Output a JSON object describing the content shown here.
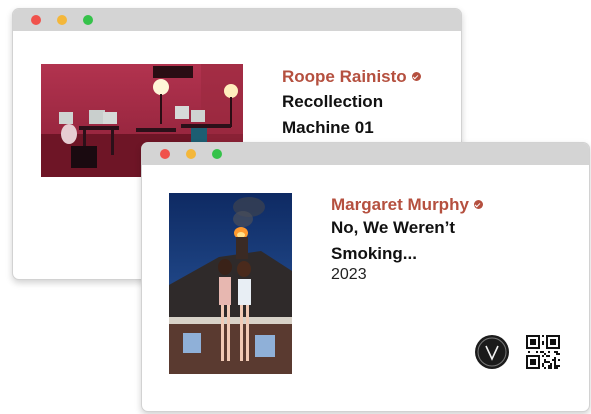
{
  "windows": [
    {
      "artist": "Roope Rainisto",
      "title_line1": "Recollection",
      "title_line2": "Machine 01"
    },
    {
      "artist": "Margaret Murphy",
      "title_line1": "No, We Weren’t",
      "title_line2": "Smoking...",
      "year": "2023"
    }
  ],
  "colors": {
    "artist": "#b5503f",
    "titlebar": "#d4d4d4",
    "close": "#f0524c",
    "minimize": "#f4b73a",
    "zoom": "#35c24a"
  },
  "icons": {
    "verified": "verified-check-icon",
    "logo": "v-logo-icon",
    "qr": "qr-code-icon"
  }
}
